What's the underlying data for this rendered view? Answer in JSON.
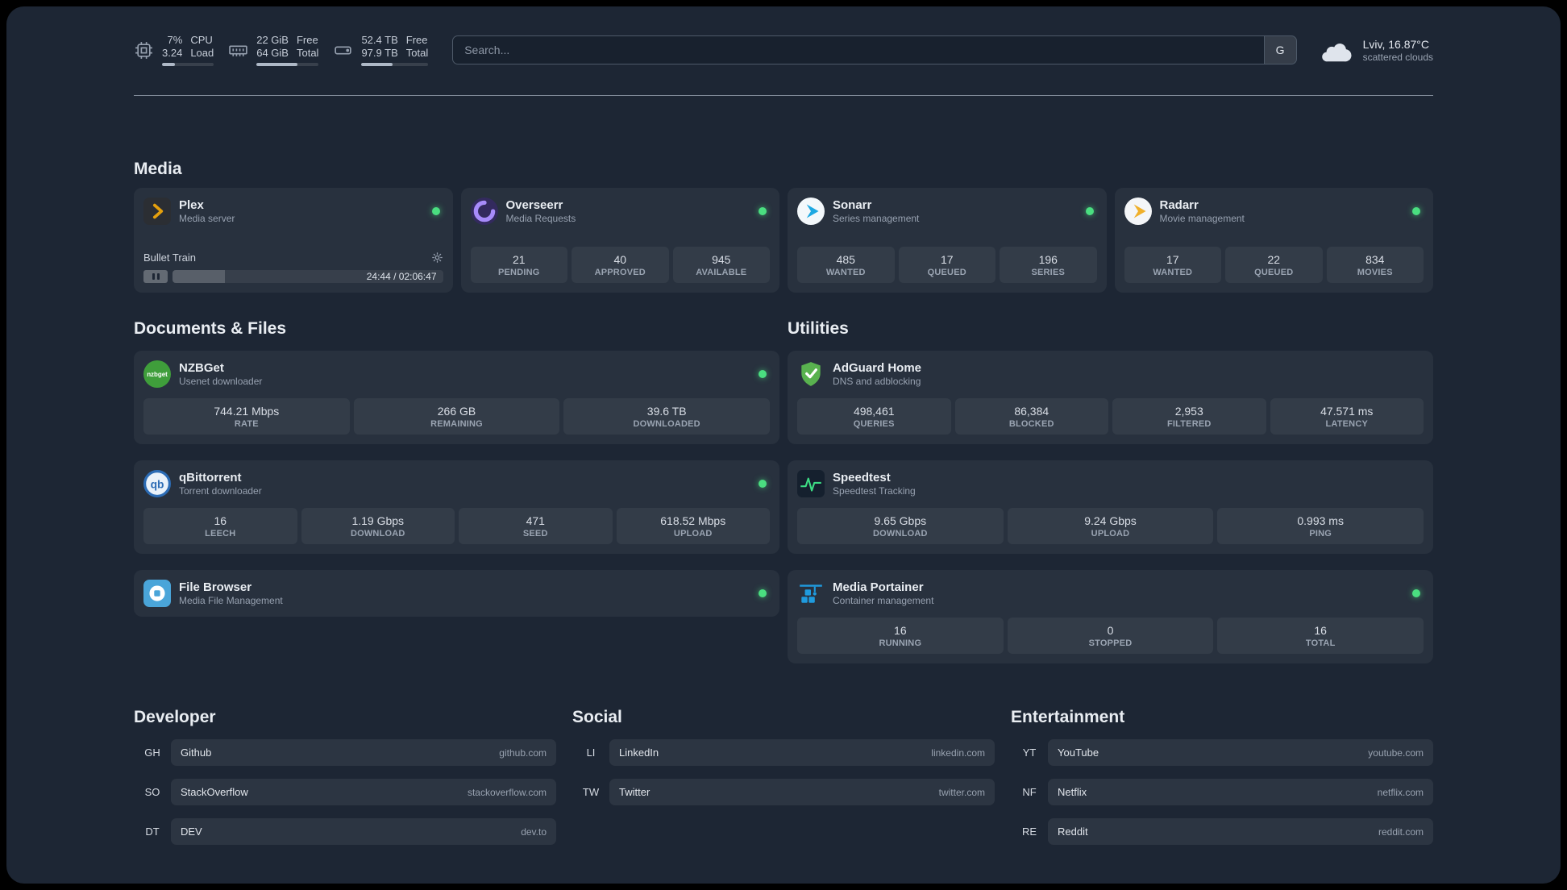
{
  "colors": {
    "background": "#1d2634",
    "status_online": "#4ade80",
    "brand": {
      "plex": "#e5a00d",
      "overseerr": "#a78bfa",
      "sonarr": "#35b5e5",
      "radarr": "#f0b02a",
      "nzbget": "#54a932",
      "qbittorrent": "#3a76b8",
      "filebrowser": "#4aa5d9",
      "adguard": "#59b24f",
      "speedtest": "#3ddc84",
      "portainer": "#1f9bde"
    }
  },
  "topbar": {
    "resources": [
      {
        "icon": "cpu-icon",
        "value_top": "7%",
        "value_bottom": "3.24",
        "label_top": "CPU",
        "label_bottom": "Load",
        "progress_pct": 25
      },
      {
        "icon": "memory-icon",
        "value_top": "22 GiB",
        "value_bottom": "64 GiB",
        "label_top": "Free",
        "label_bottom": "Total",
        "progress_pct": 66
      },
      {
        "icon": "disk-icon",
        "value_top": "52.4 TB",
        "value_bottom": "97.9 TB",
        "label_top": "Free",
        "label_bottom": "Total",
        "progress_pct": 47
      }
    ],
    "search": {
      "placeholder": "Search...",
      "provider": "G"
    },
    "weather": {
      "icon": "cloud-icon",
      "location": "Lviv, 16.87°C",
      "condition": "scattered clouds"
    }
  },
  "sections": {
    "media": {
      "title": "Media",
      "plex": {
        "name": "Plex",
        "description": "Media server",
        "now_playing": "Bullet Train",
        "time": "24:44 / 02:06:47",
        "progress_pct": 19.5
      },
      "overseerr": {
        "name": "Overseerr",
        "description": "Media Requests",
        "stats": [
          {
            "value": "21",
            "label": "PENDING"
          },
          {
            "value": "40",
            "label": "APPROVED"
          },
          {
            "value": "945",
            "label": "AVAILABLE"
          }
        ]
      },
      "sonarr": {
        "name": "Sonarr",
        "description": "Series management",
        "stats": [
          {
            "value": "485",
            "label": "WANTED"
          },
          {
            "value": "17",
            "label": "QUEUED"
          },
          {
            "value": "196",
            "label": "SERIES"
          }
        ]
      },
      "radarr": {
        "name": "Radarr",
        "description": "Movie management",
        "stats": [
          {
            "value": "17",
            "label": "WANTED"
          },
          {
            "value": "22",
            "label": "QUEUED"
          },
          {
            "value": "834",
            "label": "MOVIES"
          }
        ]
      }
    },
    "documents": {
      "title": "Documents & Files",
      "nzbget": {
        "name": "NZBGet",
        "description": "Usenet downloader",
        "stats": [
          {
            "value": "744.21 Mbps",
            "label": "RATE"
          },
          {
            "value": "266 GB",
            "label": "REMAINING"
          },
          {
            "value": "39.6 TB",
            "label": "DOWNLOADED"
          }
        ]
      },
      "qbittorrent": {
        "name": "qBittorrent",
        "description": "Torrent downloader",
        "stats": [
          {
            "value": "16",
            "label": "LEECH"
          },
          {
            "value": "1.19 Gbps",
            "label": "DOWNLOAD"
          },
          {
            "value": "471",
            "label": "SEED"
          },
          {
            "value": "618.52 Mbps",
            "label": "UPLOAD"
          }
        ]
      },
      "filebrowser": {
        "name": "File Browser",
        "description": "Media File Management"
      }
    },
    "utilities": {
      "title": "Utilities",
      "adguard": {
        "name": "AdGuard Home",
        "description": "DNS and adblocking",
        "stats": [
          {
            "value": "498,461",
            "label": "QUERIES"
          },
          {
            "value": "86,384",
            "label": "BLOCKED"
          },
          {
            "value": "2,953",
            "label": "FILTERED"
          },
          {
            "value": "47.571 ms",
            "label": "LATENCY"
          }
        ]
      },
      "speedtest": {
        "name": "Speedtest",
        "description": "Speedtest Tracking",
        "stats": [
          {
            "value": "9.65 Gbps",
            "label": "DOWNLOAD"
          },
          {
            "value": "9.24 Gbps",
            "label": "UPLOAD"
          },
          {
            "value": "0.993 ms",
            "label": "PING"
          }
        ]
      },
      "portainer": {
        "name": "Media Portainer",
        "description": "Container management",
        "stats": [
          {
            "value": "16",
            "label": "RUNNING"
          },
          {
            "value": "0",
            "label": "STOPPED"
          },
          {
            "value": "16",
            "label": "TOTAL"
          }
        ]
      }
    }
  },
  "bookmarks": [
    {
      "title": "Developer",
      "items": [
        {
          "abbr": "GH",
          "name": "Github",
          "url": "github.com"
        },
        {
          "abbr": "SO",
          "name": "StackOverflow",
          "url": "stackoverflow.com"
        },
        {
          "abbr": "DT",
          "name": "DEV",
          "url": "dev.to"
        }
      ]
    },
    {
      "title": "Social",
      "items": [
        {
          "abbr": "LI",
          "name": "LinkedIn",
          "url": "linkedin.com"
        },
        {
          "abbr": "TW",
          "name": "Twitter",
          "url": "twitter.com"
        }
      ]
    },
    {
      "title": "Entertainment",
      "items": [
        {
          "abbr": "YT",
          "name": "YouTube",
          "url": "youtube.com"
        },
        {
          "abbr": "NF",
          "name": "Netflix",
          "url": "netflix.com"
        },
        {
          "abbr": "RE",
          "name": "Reddit",
          "url": "reddit.com"
        }
      ]
    }
  ]
}
